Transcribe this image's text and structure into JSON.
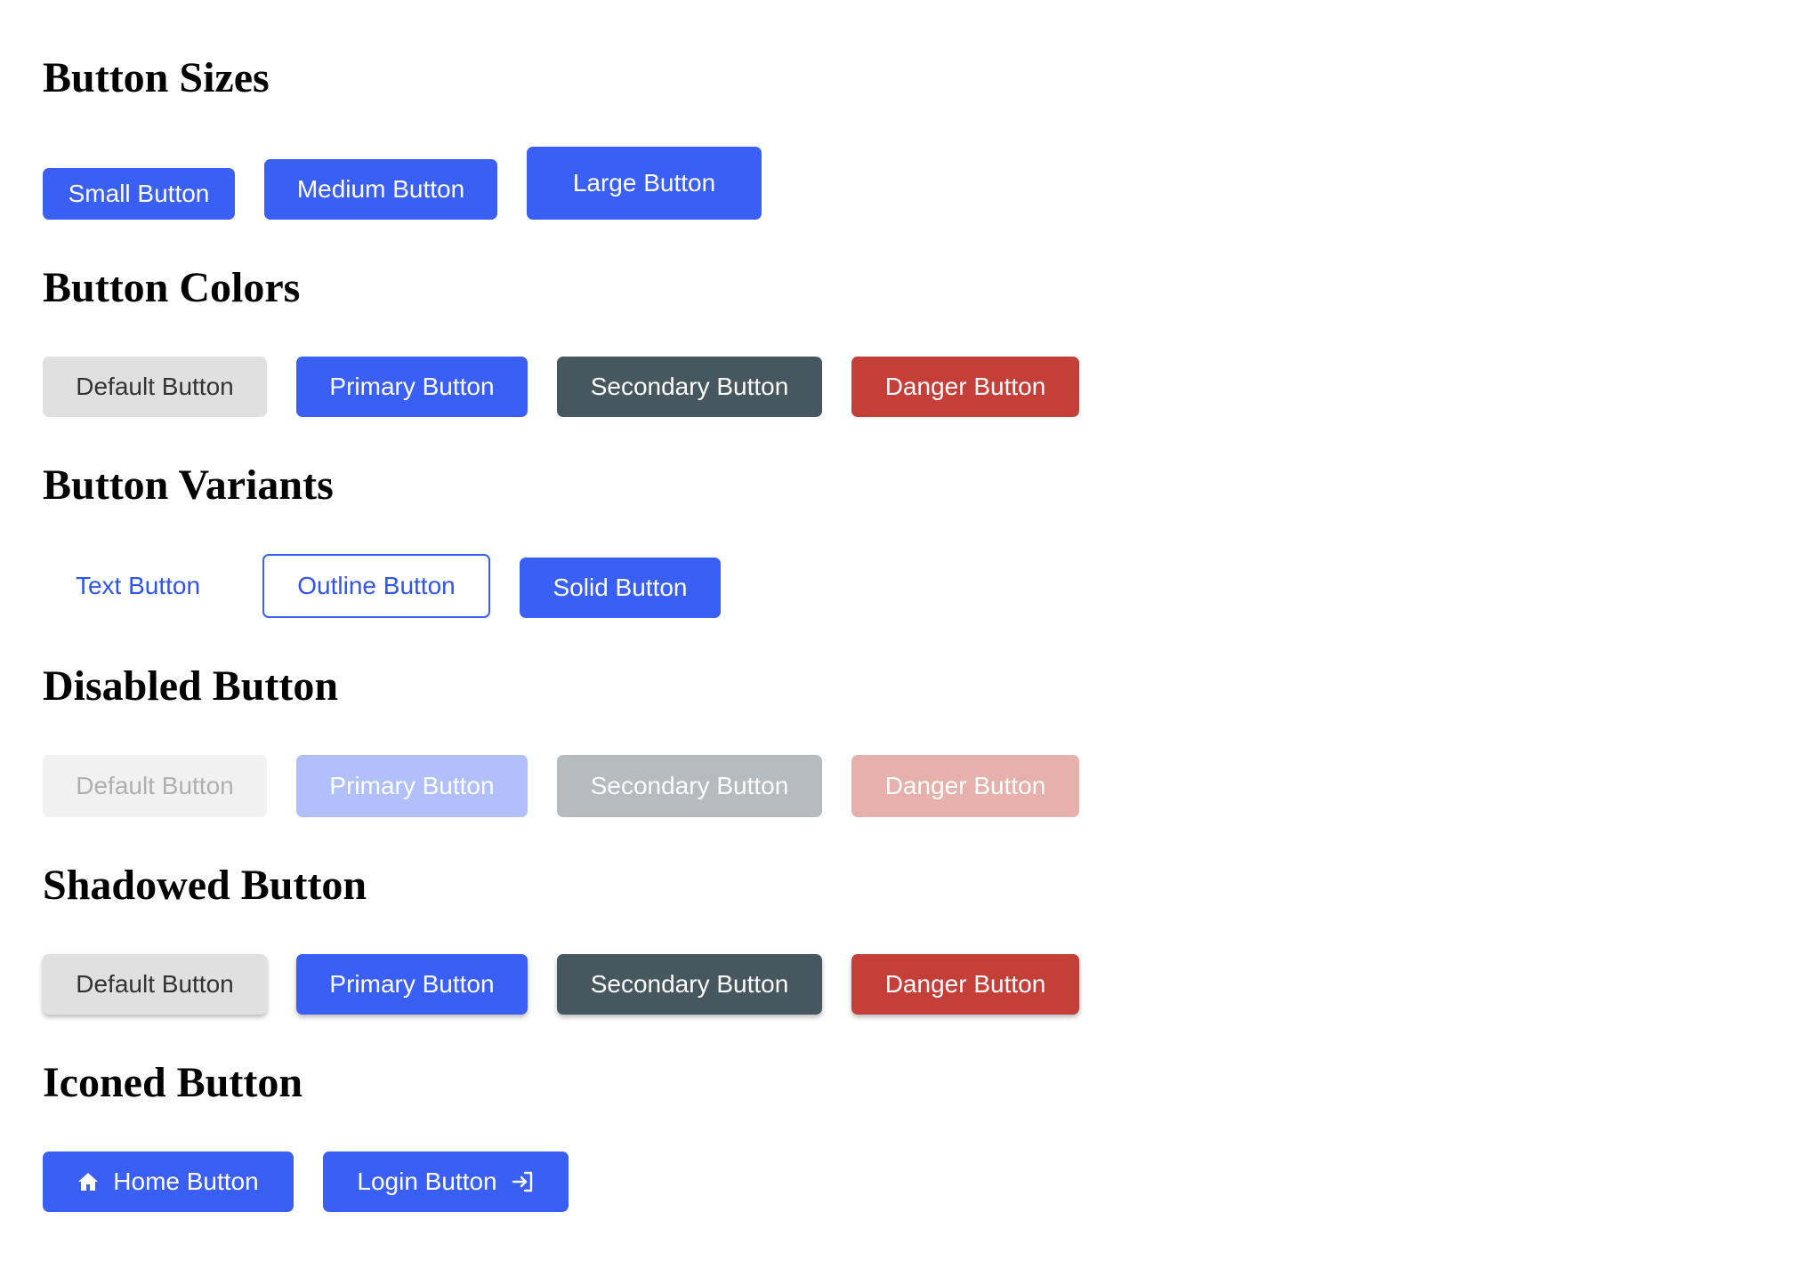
{
  "sections": {
    "sizes": {
      "title": "Button Sizes",
      "buttons": {
        "small": "Small Button",
        "medium": "Medium Button",
        "large": "Large Button"
      }
    },
    "colors": {
      "title": "Button Colors",
      "buttons": {
        "default": "Default Button",
        "primary": "Primary Button",
        "secondary": "Secondary Button",
        "danger": "Danger Button"
      }
    },
    "variants": {
      "title": "Button Variants",
      "buttons": {
        "text": "Text Button",
        "outline": "Outline Button",
        "solid": "Solid Button"
      }
    },
    "disabled": {
      "title": "Disabled Button",
      "buttons": {
        "default": "Default Button",
        "primary": "Primary Button",
        "secondary": "Secondary Button",
        "danger": "Danger Button"
      }
    },
    "shadowed": {
      "title": "Shadowed Button",
      "buttons": {
        "default": "Default Button",
        "primary": "Primary Button",
        "secondary": "Secondary Button",
        "danger": "Danger Button"
      }
    },
    "iconed": {
      "title": "Iconed Button",
      "buttons": {
        "home": {
          "label": "Home Button",
          "icon": "home-icon"
        },
        "login": {
          "label": "Login Button",
          "icon": "login-icon"
        }
      }
    }
  },
  "colors": {
    "primary": "#3a5ff5",
    "default": "#e0e0e0",
    "secondary": "#465760",
    "danger": "#c53f39"
  }
}
